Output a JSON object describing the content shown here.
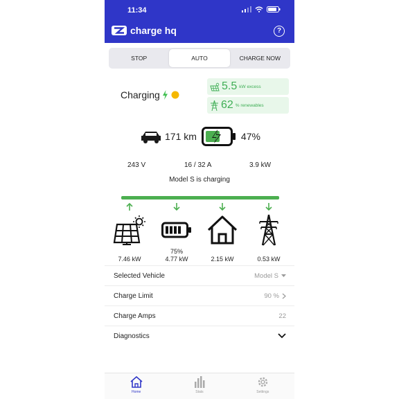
{
  "status_bar": {
    "time": "11:34"
  },
  "header": {
    "brand": "charge hq",
    "help_icon": "question-circle-icon"
  },
  "modes": {
    "items": [
      {
        "label": "STOP"
      },
      {
        "label": "AUTO"
      },
      {
        "label": "CHARGE NOW"
      }
    ],
    "selected": "AUTO"
  },
  "summary": {
    "charging_label": "Charging",
    "excess_value": "5.5",
    "excess_unit": "kW excess",
    "renewables_value": "62",
    "renewables_unit": "% renewables"
  },
  "vehicle": {
    "range": "171 km",
    "battery_percent": "47%"
  },
  "electrical": {
    "voltage": "243 V",
    "current": "16 / 32 A",
    "power": "3.9 kW"
  },
  "status_text": "Model S is charging",
  "flows": [
    {
      "name": "solar",
      "direction": "up",
      "sub": "",
      "kw": "7.46 kW"
    },
    {
      "name": "home-battery",
      "direction": "down",
      "sub": "75%",
      "kw": "4.77 kW"
    },
    {
      "name": "home",
      "direction": "down",
      "sub": "",
      "kw": "2.15 kW"
    },
    {
      "name": "grid",
      "direction": "down",
      "sub": "",
      "kw": "0.53 kW"
    }
  ],
  "settings": {
    "selected_vehicle_label": "Selected Vehicle",
    "selected_vehicle_value": "Model S",
    "charge_limit_label": "Charge Limit",
    "charge_limit_value": "90 %",
    "charge_amps_label": "Charge Amps",
    "charge_amps_value": "22",
    "diagnostics_label": "Diagnostics"
  },
  "tabs": [
    {
      "label": "Home"
    },
    {
      "label": "Stats"
    },
    {
      "label": "Settings"
    }
  ],
  "colors": {
    "brand": "#2f36c8",
    "green": "#4caf50",
    "light_green": "#e8f7ea",
    "text": "#1f1f1f"
  }
}
